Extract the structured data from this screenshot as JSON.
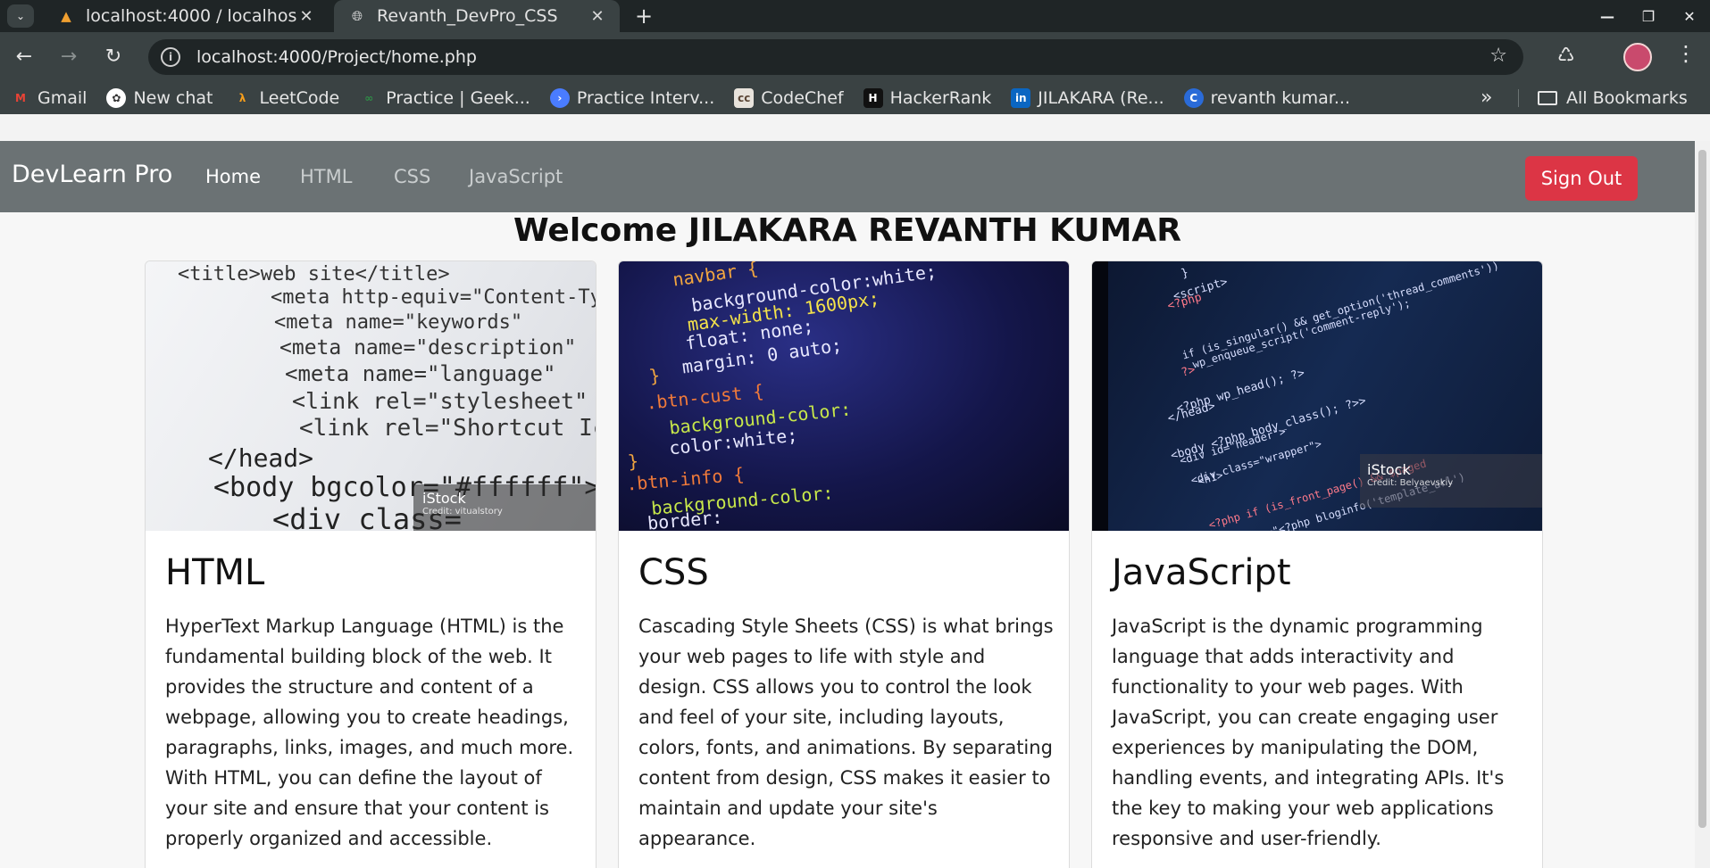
{
  "browser": {
    "tabs": [
      {
        "title": "localhost:4000 / localhos",
        "icon": "phpmyadmin-icon",
        "active": false
      },
      {
        "title": "Revanth_DevPro_CSS",
        "icon": "globe-icon",
        "active": true
      }
    ],
    "url": "localhost:4000/Project/home.php",
    "bookmarks": [
      {
        "label": "Gmail",
        "icon": "gmail-icon",
        "color": "#ea4335"
      },
      {
        "label": "New chat",
        "icon": "chatgpt-icon",
        "color": "#ffffff"
      },
      {
        "label": "LeetCode",
        "icon": "leetcode-icon",
        "color": "#f89f1b"
      },
      {
        "label": "Practice | Geek...",
        "icon": "geeksforgeeks-icon",
        "color": "#2f8d46"
      },
      {
        "label": "Practice Interv...",
        "icon": "interviewbit-icon",
        "color": "#4a7cff"
      },
      {
        "label": "CodeChef",
        "icon": "codechef-icon",
        "color": "#e8e3dc"
      },
      {
        "label": "HackerRank",
        "icon": "hackerrank-icon",
        "color": "#111111"
      },
      {
        "label": "JILAKARA (Re...",
        "icon": "linkedin-icon",
        "color": "#0a66c2"
      },
      {
        "label": "revanth kumar...",
        "icon": "c-icon",
        "color": "#2a6bd8"
      }
    ],
    "more_bookmarks": "»",
    "all_bookmarks": "All Bookmarks"
  },
  "navbar": {
    "brand": "DevLearn Pro",
    "links": [
      "Home",
      "HTML",
      "CSS",
      "JavaScript"
    ],
    "active_link": "Home",
    "signout_label": "Sign Out",
    "signout_color": "#dc3545"
  },
  "welcome": "Welcome JILAKARA REVANTH KUMAR",
  "cards": [
    {
      "title": "HTML",
      "image_code": [
        "<title>web site</title>",
        "<meta http-equiv=\"Content-Type\"",
        "<meta name=\"keywords\"",
        "<meta name=\"description\"",
        "<meta name=\"language\"",
        "<link rel=\"stylesheet\"",
        "<link rel=\"Shortcut Icon\"",
        "</head>",
        "<body bgcolor=\"#ffffff\">",
        "<div class="
      ],
      "image_credit": "iStock",
      "image_credit_sub": "Credit: vitualstory",
      "text": "HyperText Markup Language (HTML) is the fundamental building block of the web. It provides the structure and content of a webpage, allowing you to create headings, paragraphs, links, images, and much more. With HTML, you can define the layout of your site and ensure that your content is properly organized and accessible."
    },
    {
      "title": "CSS",
      "image_code": [
        "navbar {",
        "background-color:white;",
        "max-width: 1600px;",
        "float: none;",
        "margin: 0 auto;",
        "}",
        ".btn-cust {",
        "background-color:",
        "color:white;",
        "}",
        ".btn-info {",
        "background-color:",
        "border:"
      ],
      "image_credit": "",
      "image_credit_sub": "",
      "text": "Cascading Style Sheets (CSS) is what brings your web pages to life with style and design. CSS allows you to control the look and feel of your site, including layouts, colors, fonts, and animations. By separating content from design, CSS makes it easier to maintain and update your site's appearance."
    },
    {
      "title": "JavaScript",
      "image_code": [
        "}",
        "<script>",
        "<?php",
        "if (is_singular() && get_option('thread_comments'))",
        "wp_enqueue_script('comment-reply');",
        "?>",
        "<?php wp_head(); ?>",
        "</head>",
        "<body <?php body_class(); ?>>",
        "<div id=\"header\">",
        "<div class=\"wrapper\">",
        "<h1>",
        "<?php if (is_front_page() && $paged",
        "<img src=\"<?php bloginfo('template_url')"
      ],
      "image_credit": "iStock",
      "image_credit_sub": "Credit: Belyaevskiy",
      "text": "JavaScript is the dynamic programming language that adds interactivity and functionality to your web pages. With JavaScript, you can create engaging user experiences by manipulating the DOM, handling events, and integrating APIs. It's the key to making your web applications responsive and user-friendly."
    }
  ]
}
